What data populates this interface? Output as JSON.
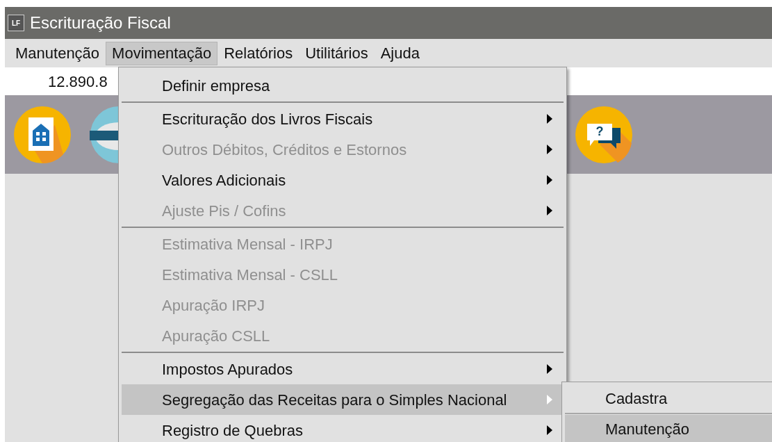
{
  "window": {
    "title": "Escrituração Fiscal",
    "app_badge": "LF"
  },
  "menubar": [
    {
      "label": "Manutenção",
      "selected": false
    },
    {
      "label": "Movimentação",
      "selected": true
    },
    {
      "label": "Relatórios",
      "selected": false
    },
    {
      "label": "Utilitários",
      "selected": false
    },
    {
      "label": "Ajuda",
      "selected": false
    }
  ],
  "company_field": {
    "value": "12.890.8"
  },
  "help_icon": {
    "glyph": "?"
  },
  "menu": [
    {
      "kind": "item",
      "label": "Definir empresa",
      "disabled": false,
      "submenu": false,
      "selected": false
    },
    {
      "kind": "separator"
    },
    {
      "kind": "item",
      "label": "Escrituração dos Livros Fiscais",
      "disabled": false,
      "submenu": true,
      "selected": false
    },
    {
      "kind": "item",
      "label": "Outros Débitos, Créditos e Estornos",
      "disabled": true,
      "submenu": true,
      "selected": false
    },
    {
      "kind": "item",
      "label": "Valores Adicionais",
      "disabled": false,
      "submenu": true,
      "selected": false
    },
    {
      "kind": "item",
      "label": "Ajuste Pis / Cofins",
      "disabled": true,
      "submenu": true,
      "selected": false
    },
    {
      "kind": "separator"
    },
    {
      "kind": "item",
      "label": "Estimativa Mensal - IRPJ",
      "disabled": true,
      "submenu": false,
      "selected": false
    },
    {
      "kind": "item",
      "label": "Estimativa Mensal - CSLL",
      "disabled": true,
      "submenu": false,
      "selected": false
    },
    {
      "kind": "item",
      "label": "Apuração IRPJ",
      "disabled": true,
      "submenu": false,
      "selected": false
    },
    {
      "kind": "item",
      "label": "Apuração CSLL",
      "disabled": true,
      "submenu": false,
      "selected": false
    },
    {
      "kind": "separator"
    },
    {
      "kind": "item",
      "label": "Impostos Apurados",
      "disabled": false,
      "submenu": true,
      "selected": false
    },
    {
      "kind": "item",
      "label": "Segregação das Receitas para o Simples Nacional",
      "disabled": false,
      "submenu": true,
      "selected": true
    },
    {
      "kind": "item",
      "label": "Registro de Quebras",
      "disabled": false,
      "submenu": true,
      "selected": false
    }
  ],
  "submenu": [
    {
      "kind": "item",
      "label": "Cadastra",
      "selected": false
    },
    {
      "kind": "separator"
    },
    {
      "kind": "item",
      "label": "Manutenção",
      "selected": true
    }
  ]
}
